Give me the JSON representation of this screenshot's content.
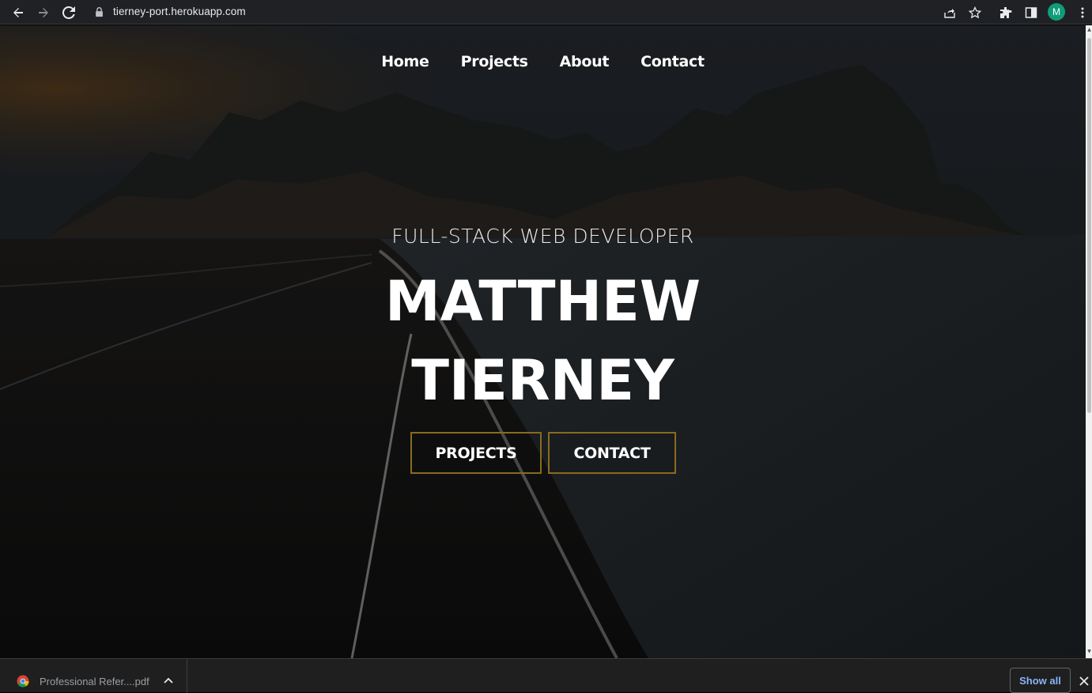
{
  "browser": {
    "url": "tierney-port.herokuapp.com",
    "avatar_letter": "M",
    "icons": [
      "back-icon",
      "forward-icon",
      "reload-icon",
      "lock-icon",
      "share-icon",
      "star-icon",
      "extensions-icon",
      "side-panel-icon",
      "menu-icon"
    ]
  },
  "nav": {
    "items": [
      {
        "label": "Home"
      },
      {
        "label": "Projects"
      },
      {
        "label": "About"
      },
      {
        "label": "Contact"
      }
    ]
  },
  "hero": {
    "subtitle": "FULL-STACK WEB DEVELOPER",
    "name_line1": "MATTHEW",
    "name_line2": "TIERNEY",
    "buttons": {
      "projects": "PROJECTS",
      "contact": "CONTACT"
    },
    "accent_color": "#8a6b1c"
  },
  "downloads": {
    "file_name": "Professional Refer....pdf",
    "show_all": "Show all"
  }
}
